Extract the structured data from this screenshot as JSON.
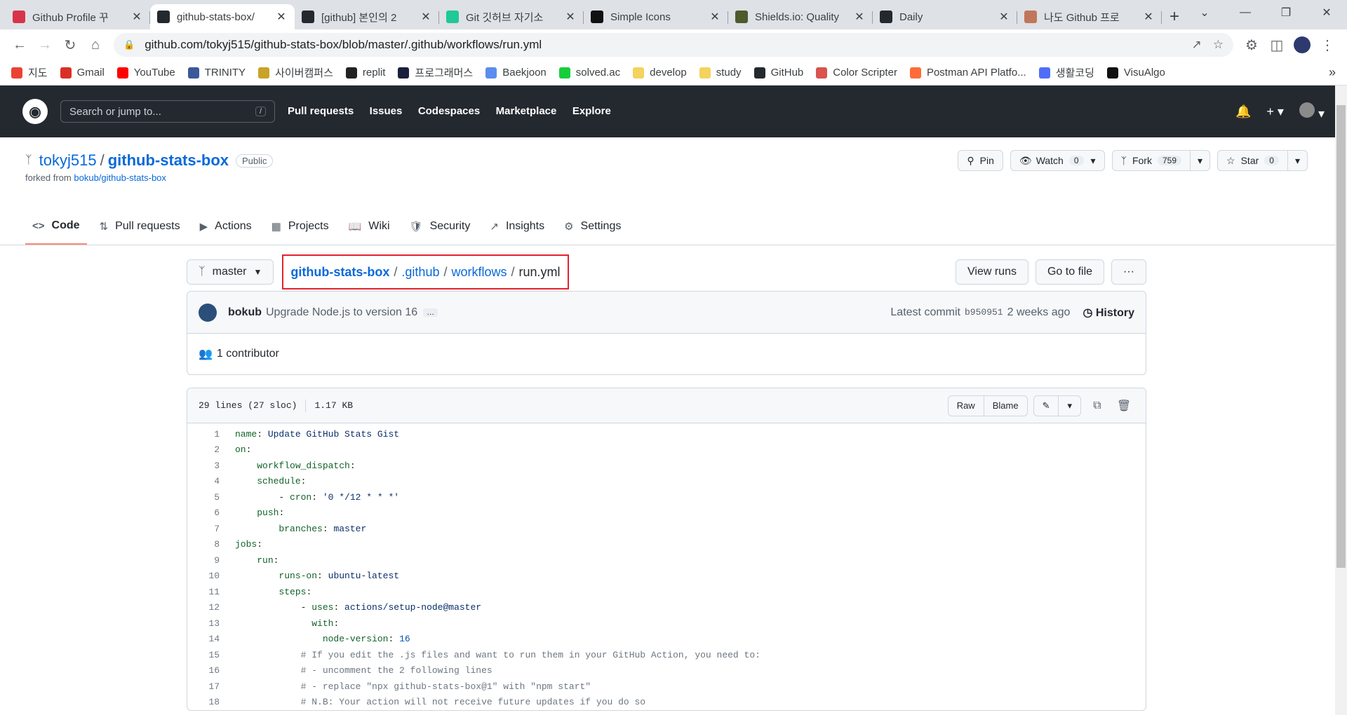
{
  "browser": {
    "tabs": [
      {
        "title": "Github Profile 꾸",
        "icon": "pin-icon",
        "color": "#d7344a",
        "active": false
      },
      {
        "title": "github-stats-box/",
        "icon": "github-icon",
        "color": "#24292f",
        "active": true
      },
      {
        "title": "[github] 본인의 2",
        "icon": "velog-icon",
        "color": "#24292f",
        "active": false
      },
      {
        "title": "Git 깃허브 자기소",
        "icon": "v-icon",
        "color": "#20c997",
        "active": false
      },
      {
        "title": "Simple Icons",
        "icon": "simple-icons-icon",
        "color": "#111111",
        "active": false
      },
      {
        "title": "Shields.io: Quality",
        "icon": "shields-icon",
        "color": "#4c5a2c",
        "active": false
      },
      {
        "title": "Daily",
        "icon": "github-icon",
        "color": "#24292f",
        "active": false
      },
      {
        "title": "나도 Github 프로",
        "icon": "cat-icon",
        "color": "#c0765a",
        "active": false
      }
    ],
    "url": "github.com/tokyj515/github-stats-box/blob/master/.github/workflows/run.yml",
    "bookmarks": [
      {
        "label": "지도",
        "color": "#ea4335"
      },
      {
        "label": "Gmail",
        "color": "#d93025"
      },
      {
        "label": "YouTube",
        "color": "#ff0000"
      },
      {
        "label": "TRINITY",
        "color": "#3b5998"
      },
      {
        "label": "사이버캠퍼스",
        "color": "#c9a227"
      },
      {
        "label": "replit",
        "color": "#222222"
      },
      {
        "label": "프로그래머스",
        "color": "#1b1f3b"
      },
      {
        "label": "Baekjoon",
        "color": "#5a8dee"
      },
      {
        "label": "solved.ac",
        "color": "#17ce3a"
      },
      {
        "label": "develop",
        "color": "#f4d35e"
      },
      {
        "label": "study",
        "color": "#f4d35e"
      },
      {
        "label": "GitHub",
        "color": "#24292f"
      },
      {
        "label": "Color Scripter",
        "color": "#d9534f"
      },
      {
        "label": "Postman API Platfo...",
        "color": "#ff6c37"
      },
      {
        "label": "생활코딩",
        "color": "#4f6ef7"
      },
      {
        "label": "VisuAlgo",
        "color": "#111111"
      }
    ]
  },
  "gh": {
    "search_placeholder": "Search or jump to...",
    "search_key": "/",
    "nav": [
      "Pull requests",
      "Issues",
      "Codespaces",
      "Marketplace",
      "Explore"
    ]
  },
  "repo": {
    "owner": "tokyj515",
    "name": "github-stats-box",
    "visibility": "Public",
    "forked_prefix": "forked from",
    "forked_from": "bokub/github-stats-box",
    "pin_label": "Pin",
    "watch_label": "Watch",
    "watch_count": "0",
    "fork_label": "Fork",
    "fork_count": "759",
    "star_label": "Star",
    "star_count": "0",
    "tabs": [
      {
        "label": "Code",
        "icon": "code-icon",
        "active": true
      },
      {
        "label": "Pull requests",
        "icon": "pull-request-icon",
        "active": false
      },
      {
        "label": "Actions",
        "icon": "play-icon",
        "active": false
      },
      {
        "label": "Projects",
        "icon": "table-icon",
        "active": false
      },
      {
        "label": "Wiki",
        "icon": "book-icon",
        "active": false
      },
      {
        "label": "Security",
        "icon": "shield-icon",
        "active": false
      },
      {
        "label": "Insights",
        "icon": "graph-icon",
        "active": false
      },
      {
        "label": "Settings",
        "icon": "gear-icon",
        "active": false
      }
    ]
  },
  "path": {
    "branch": "master",
    "crumbs": [
      "github-stats-box",
      ".github",
      "workflows"
    ],
    "file": "run.yml",
    "view_runs": "View runs",
    "go_to_file": "Go to file",
    "more": "···"
  },
  "commit": {
    "author": "bokub",
    "message": "Upgrade Node.js to version 16",
    "ellipsis": "…",
    "latest_label": "Latest commit",
    "sha": "b950951",
    "when": "2 weeks ago",
    "history": "History",
    "contributors": "1 contributor"
  },
  "file": {
    "lines_info": "29 lines (27 sloc)",
    "size": "1.17 KB",
    "raw": "Raw",
    "blame": "Blame",
    "code": [
      {
        "n": "1",
        "indent": "",
        "key": "name",
        "val": "Update GitHub Stats Gist",
        "type": "str"
      },
      {
        "n": "2",
        "indent": "",
        "key": "on",
        "val": "",
        "type": "str"
      },
      {
        "n": "3",
        "indent": "    ",
        "key": "workflow_dispatch",
        "val": "",
        "type": "str"
      },
      {
        "n": "4",
        "indent": "    ",
        "key": "schedule",
        "val": "",
        "type": "str"
      },
      {
        "n": "5",
        "indent": "        - ",
        "key": "cron",
        "val": "'0 */12 * * *'",
        "type": "str"
      },
      {
        "n": "6",
        "indent": "    ",
        "key": "push",
        "val": "",
        "type": "str"
      },
      {
        "n": "7",
        "indent": "        ",
        "key": "branches",
        "val": "master",
        "type": "str"
      },
      {
        "n": "8",
        "indent": "",
        "key": "jobs",
        "val": "",
        "type": "str"
      },
      {
        "n": "9",
        "indent": "    ",
        "key": "run",
        "val": "",
        "type": "str"
      },
      {
        "n": "10",
        "indent": "        ",
        "key": "runs-on",
        "val": "ubuntu-latest",
        "type": "str"
      },
      {
        "n": "11",
        "indent": "        ",
        "key": "steps",
        "val": "",
        "type": "str"
      },
      {
        "n": "12",
        "indent": "            - ",
        "key": "uses",
        "val": "actions/setup-node@master",
        "type": "str"
      },
      {
        "n": "13",
        "indent": "              ",
        "key": "with",
        "val": "",
        "type": "str"
      },
      {
        "n": "14",
        "indent": "                ",
        "key": "node-version",
        "val": "16",
        "type": "num"
      },
      {
        "n": "15",
        "indent": "            ",
        "key": "",
        "val": "# If you edit the .js files and want to run them in your GitHub Action, you need to:",
        "type": "comment"
      },
      {
        "n": "16",
        "indent": "            ",
        "key": "",
        "val": "# - uncomment the 2 following lines",
        "type": "comment"
      },
      {
        "n": "17",
        "indent": "            ",
        "key": "",
        "val": "# - replace \"npx github-stats-box@1\" with \"npm start\"",
        "type": "comment"
      },
      {
        "n": "18",
        "indent": "            ",
        "key": "",
        "val": "# N.B: Your action will not receive future updates if you do so",
        "type": "comment"
      }
    ]
  }
}
